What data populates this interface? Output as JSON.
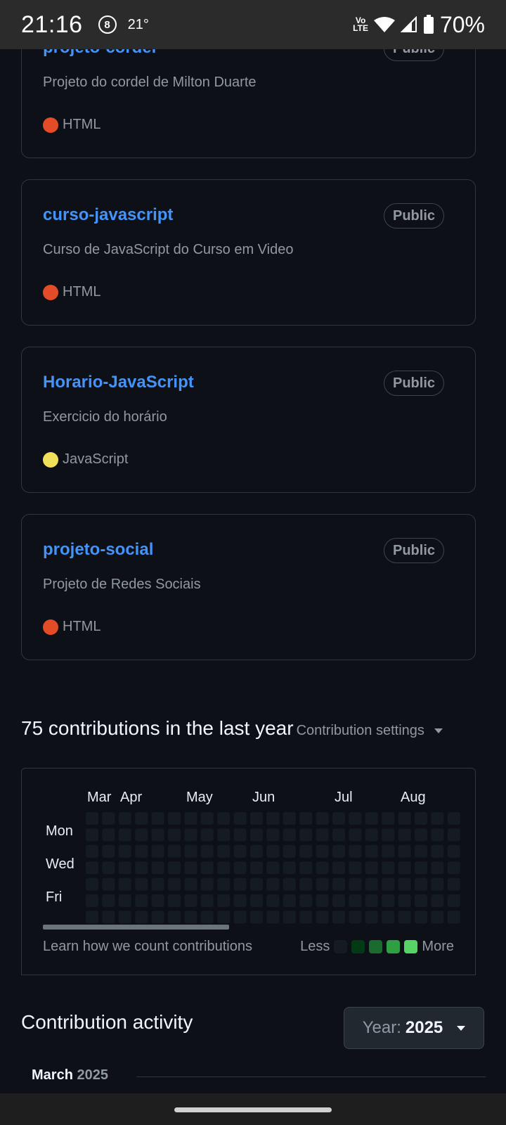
{
  "status_bar": {
    "time": "21:16",
    "notification": "8",
    "temperature": "21°",
    "volte_line1": "Vo",
    "volte_line2": "LTE",
    "battery": "70%"
  },
  "repos": [
    {
      "name": "projeto-cordel",
      "visibility": "Public",
      "description": "Projeto do cordel de Milton Duarte",
      "language": "HTML",
      "lang_color": "#e34c26"
    },
    {
      "name": "curso-javascript",
      "visibility": "Public",
      "description": "Curso de JavaScript do Curso em Video",
      "language": "HTML",
      "lang_color": "#e34c26"
    },
    {
      "name": "Horario-JavaScript",
      "visibility": "Public",
      "description": "Exercicio do horário",
      "language": "JavaScript",
      "lang_color": "#f1e05a"
    },
    {
      "name": "projeto-social",
      "visibility": "Public",
      "description": "Projeto de Redes Sociais",
      "language": "HTML",
      "lang_color": "#e34c26"
    }
  ],
  "contributions": {
    "title": "75 contributions in the last year",
    "settings_label": "Contribution settings",
    "months": [
      "Mar",
      "Apr",
      "May",
      "Jun",
      "Jul",
      "Aug"
    ],
    "days": [
      "Mon",
      "Wed",
      "Fri"
    ],
    "learn_link": "Learn how we count contributions",
    "legend_less": "Less",
    "legend_more": "More",
    "legend_colors": [
      "#151b23",
      "#033a16",
      "#196c2e",
      "#2ea043",
      "#56d364"
    ],
    "empty_color": "#151b23"
  },
  "activity": {
    "title": "Contribution activity",
    "year_label": "Year:",
    "year_value": "2025",
    "month": "March",
    "month_year": "2025"
  }
}
